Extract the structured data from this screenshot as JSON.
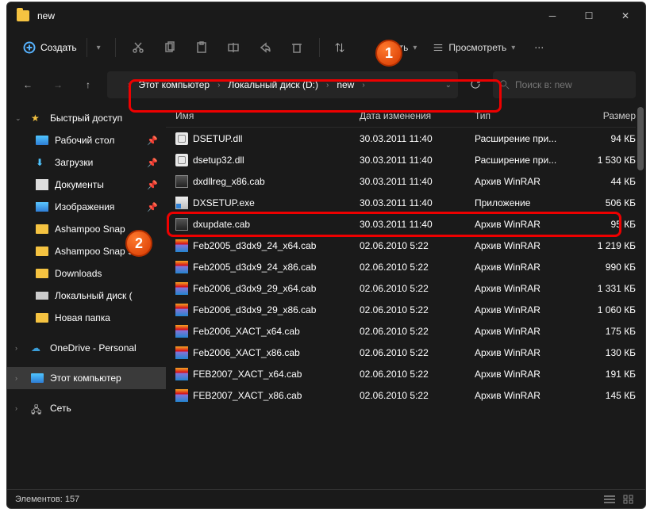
{
  "title": "new",
  "toolbar": {
    "create": "Создать",
    "sort": "ровать",
    "view": "Просмотреть"
  },
  "breadcrumb": [
    "Этот компьютер",
    "Локальный диск (D:)",
    "new"
  ],
  "search_placeholder": "Поиск в: new",
  "columns": {
    "name": "Имя",
    "date": "Дата изменения",
    "type": "Тип",
    "size": "Размер"
  },
  "sidebar": {
    "quick": "Быстрый доступ",
    "items": [
      {
        "label": "Рабочий стол",
        "pin": true,
        "ico": "desktop"
      },
      {
        "label": "Загрузки",
        "pin": true,
        "ico": "down"
      },
      {
        "label": "Документы",
        "pin": true,
        "ico": "doc"
      },
      {
        "label": "Изображения",
        "pin": true,
        "ico": "img"
      },
      {
        "label": "Ashampoo Snap",
        "ico": "folder"
      },
      {
        "label": "Ashampoo Snap 9",
        "ico": "folder"
      },
      {
        "label": "Downloads",
        "ico": "folder"
      },
      {
        "label": "Локальный диск (",
        "ico": "disk"
      },
      {
        "label": "Новая папка",
        "ico": "folder"
      }
    ],
    "onedrive": "OneDrive - Personal",
    "thispc": "Этот компьютер",
    "network": "Сеть"
  },
  "files": [
    {
      "name": "DSETUP.dll",
      "date": "30.03.2011 11:40",
      "type": "Расширение при...",
      "size": "94 КБ",
      "ico": "dll"
    },
    {
      "name": "dsetup32.dll",
      "date": "30.03.2011 11:40",
      "type": "Расширение при...",
      "size": "1 530 КБ",
      "ico": "dll"
    },
    {
      "name": "dxdllreg_x86.cab",
      "date": "30.03.2011 11:40",
      "type": "Архив WinRAR",
      "size": "44 КБ",
      "ico": "cab"
    },
    {
      "name": "DXSETUP.exe",
      "date": "30.03.2011 11:40",
      "type": "Приложение",
      "size": "506 КБ",
      "ico": "exe"
    },
    {
      "name": "dxupdate.cab",
      "date": "30.03.2011 11:40",
      "type": "Архив WinRAR",
      "size": "95 КБ",
      "ico": "cab"
    },
    {
      "name": "Feb2005_d3dx9_24_x64.cab",
      "date": "02.06.2010 5:22",
      "type": "Архив WinRAR",
      "size": "1 219 КБ",
      "ico": "rar"
    },
    {
      "name": "Feb2005_d3dx9_24_x86.cab",
      "date": "02.06.2010 5:22",
      "type": "Архив WinRAR",
      "size": "990 КБ",
      "ico": "rar"
    },
    {
      "name": "Feb2006_d3dx9_29_x64.cab",
      "date": "02.06.2010 5:22",
      "type": "Архив WinRAR",
      "size": "1 331 КБ",
      "ico": "rar"
    },
    {
      "name": "Feb2006_d3dx9_29_x86.cab",
      "date": "02.06.2010 5:22",
      "type": "Архив WinRAR",
      "size": "1 060 КБ",
      "ico": "rar"
    },
    {
      "name": "Feb2006_XACT_x64.cab",
      "date": "02.06.2010 5:22",
      "type": "Архив WinRAR",
      "size": "175 КБ",
      "ico": "rar"
    },
    {
      "name": "Feb2006_XACT_x86.cab",
      "date": "02.06.2010 5:22",
      "type": "Архив WinRAR",
      "size": "130 КБ",
      "ico": "rar"
    },
    {
      "name": "FEB2007_XACT_x64.cab",
      "date": "02.06.2010 5:22",
      "type": "Архив WinRAR",
      "size": "191 КБ",
      "ico": "rar"
    },
    {
      "name": "FEB2007_XACT_x86.cab",
      "date": "02.06.2010 5:22",
      "type": "Архив WinRAR",
      "size": "145 КБ",
      "ico": "rar"
    }
  ],
  "status": "Элементов: 157",
  "badges": {
    "1": "1",
    "2": "2"
  }
}
